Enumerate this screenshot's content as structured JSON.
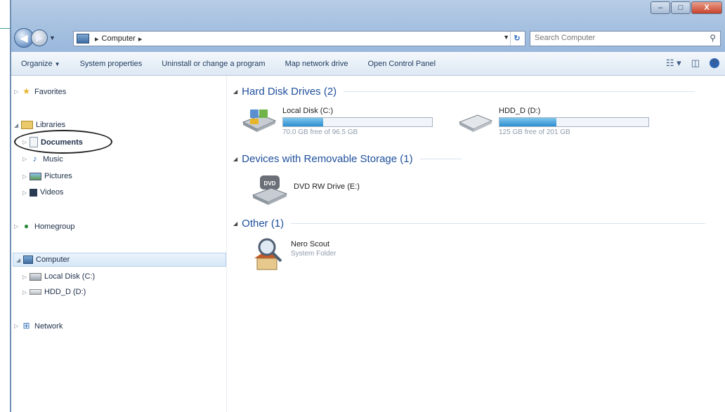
{
  "window": {
    "buttons": {
      "minimize": "–",
      "maximize": "□",
      "close": "X"
    }
  },
  "address": {
    "segments": [
      "Computer"
    ],
    "separator": "▸",
    "refresh_glyph": "↻"
  },
  "search": {
    "placeholder": "Search Computer"
  },
  "toolbar": {
    "items": [
      "Organize",
      "System properties",
      "Uninstall or change a program",
      "Map network drive",
      "Open Control Panel"
    ],
    "organize_dropdown": "▼",
    "view_glyph": "☷ ▾",
    "pane_glyph": "◫",
    "help_label": "?"
  },
  "nav": {
    "favorites": "Favorites",
    "libraries": "Libraries",
    "documents": "Documents",
    "music": "Music",
    "pictures": "Pictures",
    "videos": "Videos",
    "homegroup": "Homegroup",
    "computer": "Computer",
    "local_disk": "Local Disk (C:)",
    "hdd_d": "HDD_D (D:)",
    "network": "Network"
  },
  "groups": {
    "hard_disks": "Hard Disk Drives (2)",
    "removable": "Devices with Removable Storage (1)",
    "other": "Other (1)"
  },
  "drives": [
    {
      "name": "Local Disk (C:)",
      "free": "70.0 GB free of 96.5 GB",
      "used_fraction": 0.27
    },
    {
      "name": "HDD_D (D:)",
      "free": "125 GB free of 201 GB",
      "used_fraction": 0.38
    }
  ],
  "dvd": {
    "name": "DVD RW Drive (E:)",
    "label": "DVD"
  },
  "nero": {
    "name": "Nero Scout",
    "sub": "System Folder"
  },
  "colors": {
    "group_heading": "#1e4f9c",
    "bar_fill": "#2c8fd0",
    "accent": "#2d63b0"
  }
}
